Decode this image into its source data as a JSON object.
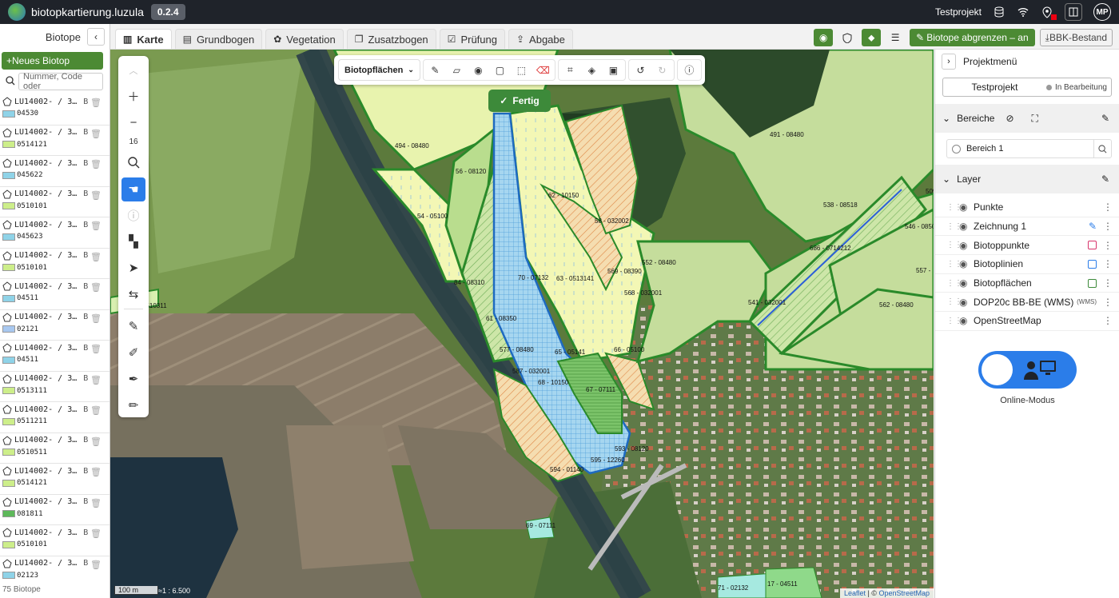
{
  "app": {
    "title": "biotopkartierung.luzula",
    "version": "0.2.4"
  },
  "topbar": {
    "project": "Testprojekt",
    "user_initials": "MP"
  },
  "left": {
    "title": "Biotope",
    "new_button": "+Neues Biotop",
    "search_placeholder": "Nummer, Code oder",
    "footer": "75 Biotope",
    "items": [
      {
        "id": "LU14002- / 3…",
        "flag": "B",
        "code": "04530",
        "color": "#8fd3e8"
      },
      {
        "id": "LU14002- / 3…",
        "flag": "B",
        "code": "0514121",
        "color": "#cdee8a"
      },
      {
        "id": "LU14002- / 3…",
        "flag": "B",
        "code": "045622",
        "color": "#8fd3e8"
      },
      {
        "id": "LU14002- / 3…",
        "flag": "B",
        "code": "0510101",
        "color": "#cdee8a"
      },
      {
        "id": "LU14002- / 3…",
        "flag": "B",
        "code": "045623",
        "color": "#8fd3e8"
      },
      {
        "id": "LU14002- / 3…",
        "flag": "B",
        "code": "0510101",
        "color": "#cdee8a"
      },
      {
        "id": "LU14002- / 3…",
        "flag": "B",
        "code": "04511",
        "color": "#8fd3e8"
      },
      {
        "id": "LU14002- / 3…",
        "flag": "B",
        "code": "02121",
        "color": "#a8c8f0"
      },
      {
        "id": "LU14002- / 3…",
        "flag": "B",
        "code": "04511",
        "color": "#8fd3e8"
      },
      {
        "id": "LU14002- / 3…",
        "flag": "B",
        "code": "0513111",
        "color": "#cdee8a"
      },
      {
        "id": "LU14002- / 3…",
        "flag": "B",
        "code": "0511211",
        "color": "#cdee8a"
      },
      {
        "id": "LU14002- / 3…",
        "flag": "B",
        "code": "0510511",
        "color": "#cdee8a"
      },
      {
        "id": "LU14002- / 3…",
        "flag": "B",
        "code": "0514121",
        "color": "#cdee8a"
      },
      {
        "id": "LU14002- / 3…",
        "flag": "B",
        "code": "081811",
        "color": "#5db85a"
      },
      {
        "id": "LU14002- / 3…",
        "flag": "B",
        "code": "0510101",
        "color": "#cdee8a"
      },
      {
        "id": "LU14002- / 3…",
        "flag": "B",
        "code": "02123",
        "color": "#8fd3e8"
      }
    ]
  },
  "tabs": [
    "Karte",
    "Grundbogen",
    "Vegetation",
    "Zusatzbogen",
    "Prüfung",
    "Abgabe"
  ],
  "tab_actions": {
    "primary": "Biotope abgrenzen – an",
    "secondary": "BBK-Bestand"
  },
  "map": {
    "layer_select": "Biotopflächen",
    "done_button": "Fertig",
    "zoom_level": "16",
    "scale": "100 m",
    "scale_ratio": "≈1 : 6.500",
    "attribution_leaflet": "Leaflet",
    "attribution_sep": " | © ",
    "attribution_osm": "OpenStreetMap",
    "labels": [
      "494 - 08480",
      "491 - 08480",
      "56 - 08120",
      "62 - 10150",
      "58 - 032002",
      "54 - 05100",
      "538 - 08518",
      "546 - 08500",
      "509",
      "552 - 08480",
      "569 - 08390",
      "686 - 0714212",
      "557 -",
      "63 - 0513141",
      "70 - 07132",
      "84 - 08310",
      "568 - 032001",
      "541 - 032001",
      "562 - 08480",
      "0510311",
      "61 - 08350",
      "577 - 08480",
      "65 - 05141",
      "66 - 05100",
      "587 - 032001",
      "68 - 10150",
      "67 - 07111",
      "593 - 08120",
      "595 - 12260",
      "594 - 01140",
      "69 - 07111",
      "71 - 02132",
      "17 - 04511",
      "16 - 071012"
    ]
  },
  "right": {
    "menu_label": "Projektmenü",
    "project_name": "Testprojekt",
    "project_status": "In Bearbeitung",
    "areas_title": "Bereiche",
    "area_item": "Bereich 1",
    "layers_title": "Layer",
    "layers": [
      {
        "name": "Punkte",
        "tag": "",
        "color": ""
      },
      {
        "name": "Zeichnung 1",
        "tag": "",
        "color": ""
      },
      {
        "name": "Biotoppunkte",
        "tag": "",
        "color": "#d8336b"
      },
      {
        "name": "Biotoplinien",
        "tag": "",
        "color": "#2b7de9"
      },
      {
        "name": "Biotopflächen",
        "tag": "",
        "color": "#3d8a3a"
      },
      {
        "name": "DOP20c BB-BE (WMS)",
        "tag": "(WMS)",
        "color": ""
      },
      {
        "name": "OpenStreetMap",
        "tag": "",
        "color": ""
      }
    ],
    "mode_label": "Online-Modus"
  }
}
